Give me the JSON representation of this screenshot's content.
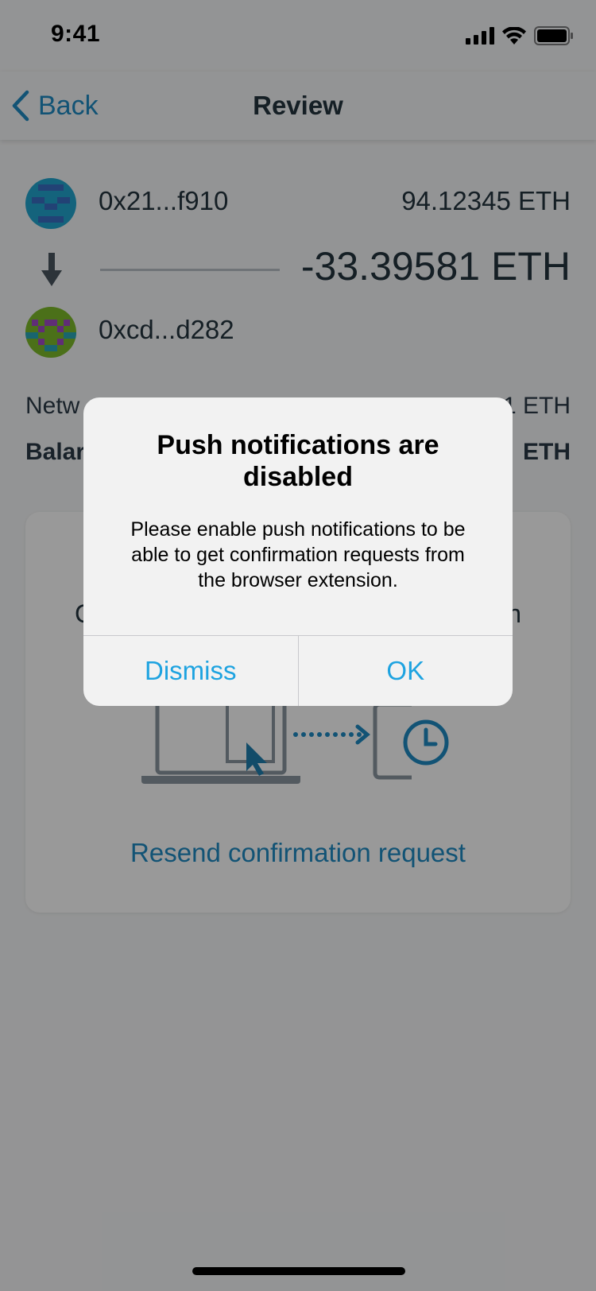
{
  "status_bar": {
    "time": "9:41"
  },
  "nav": {
    "back_label": "Back",
    "title": "Review"
  },
  "transfer": {
    "from_address": "0x21...f910",
    "from_balance": "94.12345 ETH",
    "amount": "-33.39581 ETH",
    "to_address": "0xcd...d282"
  },
  "fee_rows": {
    "network_fee_label": "Netw",
    "network_fee_value": "1 ETH",
    "balance_label": "Balar",
    "balance_value": "ETH"
  },
  "card": {
    "text_left": "C",
    "text_right": "n",
    "resend_label": "Resend confirmation request"
  },
  "alert": {
    "title": "Push notifications are disabled",
    "message": "Please enable push notifications to be able to get confirmation requests from the browser extension.",
    "dismiss_label": "Dismiss",
    "ok_label": "OK"
  },
  "colors": {
    "accent": "#1e8bc3",
    "alert_button": "#1ea3e0",
    "background": "#f6f7f8"
  }
}
